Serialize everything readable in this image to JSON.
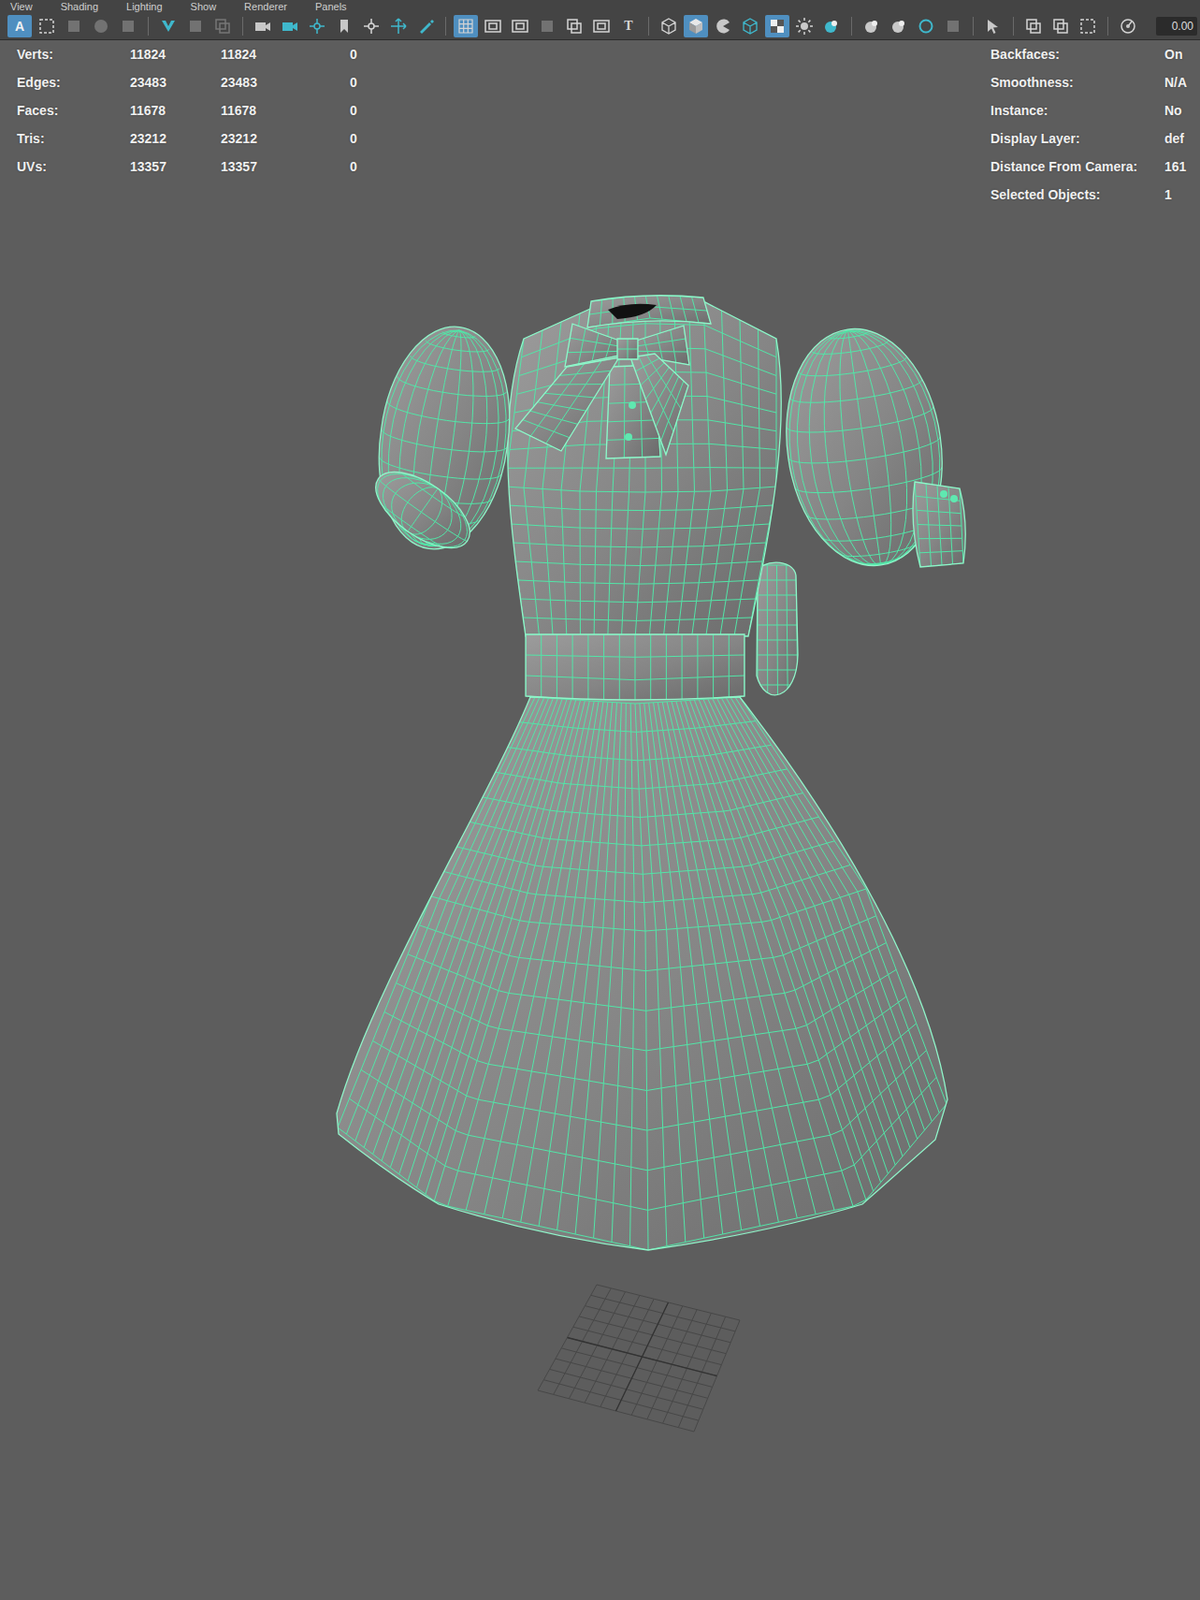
{
  "menu": [
    "View",
    "Shading",
    "Lighting",
    "Show",
    "Renderer",
    "Panels"
  ],
  "toolbar": {
    "buttons": [
      {
        "label": "A",
        "selected": true,
        "disabled": false
      },
      {
        "selected": false,
        "disabled": false
      },
      {
        "selected": false,
        "disabled": true
      },
      {
        "selected": false,
        "disabled": true
      },
      {
        "selected": false,
        "disabled": true
      },
      {
        "selected": false,
        "disabled": false
      },
      {
        "selected": false,
        "disabled": true
      },
      {
        "selected": false,
        "disabled": true
      },
      {
        "selected": false,
        "disabled": false
      },
      {
        "selected": false,
        "disabled": false
      },
      {
        "selected": false,
        "disabled": false
      },
      {
        "selected": false,
        "disabled": false
      },
      {
        "selected": false,
        "disabled": false
      },
      {
        "selected": false,
        "disabled": false
      },
      {
        "selected": false,
        "disabled": false
      },
      {
        "selected": true,
        "disabled": false
      },
      {
        "selected": false,
        "disabled": false
      },
      {
        "selected": false,
        "disabled": false
      },
      {
        "selected": false,
        "disabled": true
      },
      {
        "selected": false,
        "disabled": false
      },
      {
        "selected": false,
        "disabled": false
      },
      {
        "label": "T",
        "selected": false,
        "disabled": false
      },
      {
        "selected": false,
        "disabled": false
      },
      {
        "selected": true,
        "disabled": false
      },
      {
        "selected": false,
        "disabled": false
      },
      {
        "selected": false,
        "disabled": false
      },
      {
        "selected": true,
        "disabled": false
      },
      {
        "selected": false,
        "disabled": false
      },
      {
        "selected": false,
        "disabled": false
      },
      {
        "selected": false,
        "disabled": false
      },
      {
        "selected": false,
        "disabled": false
      },
      {
        "selected": false,
        "disabled": false
      },
      {
        "selected": false,
        "disabled": true
      },
      {
        "selected": false,
        "disabled": false
      },
      {
        "selected": false,
        "disabled": false
      },
      {
        "selected": false,
        "disabled": false
      },
      {
        "selected": false,
        "disabled": false
      },
      {
        "selected": false,
        "disabled": false
      }
    ],
    "field": "0.00"
  },
  "hud_left": [
    {
      "label": "Verts:",
      "values": [
        "11824",
        "11824",
        "0"
      ]
    },
    {
      "label": "Edges:",
      "values": [
        "23483",
        "23483",
        "0"
      ]
    },
    {
      "label": "Faces:",
      "values": [
        "11678",
        "11678",
        "0"
      ]
    },
    {
      "label": "Tris:",
      "values": [
        "23212",
        "23212",
        "0"
      ]
    },
    {
      "label": "UVs:",
      "values": [
        "13357",
        "13357",
        "0"
      ]
    }
  ],
  "hud_right": [
    {
      "label": "Backfaces:",
      "value": "On"
    },
    {
      "label": "Smoothness:",
      "value": "N/A"
    },
    {
      "label": "Instance:",
      "value": "No"
    },
    {
      "label": "Display Layer:",
      "value": "def"
    },
    {
      "label": "Distance From Camera:",
      "value": "161"
    },
    {
      "label": "Selected Objects:",
      "value": "1"
    }
  ]
}
